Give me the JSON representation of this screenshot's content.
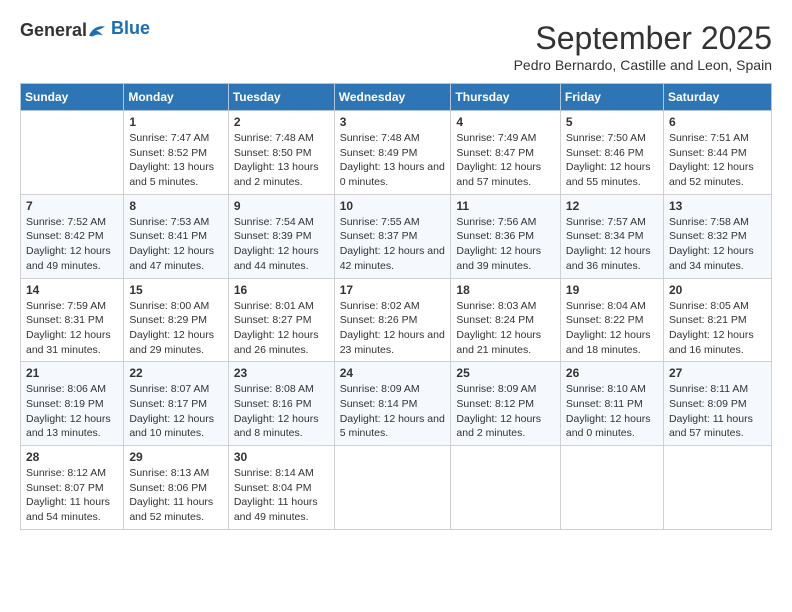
{
  "logo": {
    "general": "General",
    "blue": "Blue"
  },
  "title": "September 2025",
  "subtitle": "Pedro Bernardo, Castille and Leon, Spain",
  "weekdays": [
    "Sunday",
    "Monday",
    "Tuesday",
    "Wednesday",
    "Thursday",
    "Friday",
    "Saturday"
  ],
  "weeks": [
    [
      {
        "num": "",
        "sunrise": "",
        "sunset": "",
        "daylight": ""
      },
      {
        "num": "1",
        "sunrise": "Sunrise: 7:47 AM",
        "sunset": "Sunset: 8:52 PM",
        "daylight": "Daylight: 13 hours and 5 minutes."
      },
      {
        "num": "2",
        "sunrise": "Sunrise: 7:48 AM",
        "sunset": "Sunset: 8:50 PM",
        "daylight": "Daylight: 13 hours and 2 minutes."
      },
      {
        "num": "3",
        "sunrise": "Sunrise: 7:48 AM",
        "sunset": "Sunset: 8:49 PM",
        "daylight": "Daylight: 13 hours and 0 minutes."
      },
      {
        "num": "4",
        "sunrise": "Sunrise: 7:49 AM",
        "sunset": "Sunset: 8:47 PM",
        "daylight": "Daylight: 12 hours and 57 minutes."
      },
      {
        "num": "5",
        "sunrise": "Sunrise: 7:50 AM",
        "sunset": "Sunset: 8:46 PM",
        "daylight": "Daylight: 12 hours and 55 minutes."
      },
      {
        "num": "6",
        "sunrise": "Sunrise: 7:51 AM",
        "sunset": "Sunset: 8:44 PM",
        "daylight": "Daylight: 12 hours and 52 minutes."
      }
    ],
    [
      {
        "num": "7",
        "sunrise": "Sunrise: 7:52 AM",
        "sunset": "Sunset: 8:42 PM",
        "daylight": "Daylight: 12 hours and 49 minutes."
      },
      {
        "num": "8",
        "sunrise": "Sunrise: 7:53 AM",
        "sunset": "Sunset: 8:41 PM",
        "daylight": "Daylight: 12 hours and 47 minutes."
      },
      {
        "num": "9",
        "sunrise": "Sunrise: 7:54 AM",
        "sunset": "Sunset: 8:39 PM",
        "daylight": "Daylight: 12 hours and 44 minutes."
      },
      {
        "num": "10",
        "sunrise": "Sunrise: 7:55 AM",
        "sunset": "Sunset: 8:37 PM",
        "daylight": "Daylight: 12 hours and 42 minutes."
      },
      {
        "num": "11",
        "sunrise": "Sunrise: 7:56 AM",
        "sunset": "Sunset: 8:36 PM",
        "daylight": "Daylight: 12 hours and 39 minutes."
      },
      {
        "num": "12",
        "sunrise": "Sunrise: 7:57 AM",
        "sunset": "Sunset: 8:34 PM",
        "daylight": "Daylight: 12 hours and 36 minutes."
      },
      {
        "num": "13",
        "sunrise": "Sunrise: 7:58 AM",
        "sunset": "Sunset: 8:32 PM",
        "daylight": "Daylight: 12 hours and 34 minutes."
      }
    ],
    [
      {
        "num": "14",
        "sunrise": "Sunrise: 7:59 AM",
        "sunset": "Sunset: 8:31 PM",
        "daylight": "Daylight: 12 hours and 31 minutes."
      },
      {
        "num": "15",
        "sunrise": "Sunrise: 8:00 AM",
        "sunset": "Sunset: 8:29 PM",
        "daylight": "Daylight: 12 hours and 29 minutes."
      },
      {
        "num": "16",
        "sunrise": "Sunrise: 8:01 AM",
        "sunset": "Sunset: 8:27 PM",
        "daylight": "Daylight: 12 hours and 26 minutes."
      },
      {
        "num": "17",
        "sunrise": "Sunrise: 8:02 AM",
        "sunset": "Sunset: 8:26 PM",
        "daylight": "Daylight: 12 hours and 23 minutes."
      },
      {
        "num": "18",
        "sunrise": "Sunrise: 8:03 AM",
        "sunset": "Sunset: 8:24 PM",
        "daylight": "Daylight: 12 hours and 21 minutes."
      },
      {
        "num": "19",
        "sunrise": "Sunrise: 8:04 AM",
        "sunset": "Sunset: 8:22 PM",
        "daylight": "Daylight: 12 hours and 18 minutes."
      },
      {
        "num": "20",
        "sunrise": "Sunrise: 8:05 AM",
        "sunset": "Sunset: 8:21 PM",
        "daylight": "Daylight: 12 hours and 16 minutes."
      }
    ],
    [
      {
        "num": "21",
        "sunrise": "Sunrise: 8:06 AM",
        "sunset": "Sunset: 8:19 PM",
        "daylight": "Daylight: 12 hours and 13 minutes."
      },
      {
        "num": "22",
        "sunrise": "Sunrise: 8:07 AM",
        "sunset": "Sunset: 8:17 PM",
        "daylight": "Daylight: 12 hours and 10 minutes."
      },
      {
        "num": "23",
        "sunrise": "Sunrise: 8:08 AM",
        "sunset": "Sunset: 8:16 PM",
        "daylight": "Daylight: 12 hours and 8 minutes."
      },
      {
        "num": "24",
        "sunrise": "Sunrise: 8:09 AM",
        "sunset": "Sunset: 8:14 PM",
        "daylight": "Daylight: 12 hours and 5 minutes."
      },
      {
        "num": "25",
        "sunrise": "Sunrise: 8:09 AM",
        "sunset": "Sunset: 8:12 PM",
        "daylight": "Daylight: 12 hours and 2 minutes."
      },
      {
        "num": "26",
        "sunrise": "Sunrise: 8:10 AM",
        "sunset": "Sunset: 8:11 PM",
        "daylight": "Daylight: 12 hours and 0 minutes."
      },
      {
        "num": "27",
        "sunrise": "Sunrise: 8:11 AM",
        "sunset": "Sunset: 8:09 PM",
        "daylight": "Daylight: 11 hours and 57 minutes."
      }
    ],
    [
      {
        "num": "28",
        "sunrise": "Sunrise: 8:12 AM",
        "sunset": "Sunset: 8:07 PM",
        "daylight": "Daylight: 11 hours and 54 minutes."
      },
      {
        "num": "29",
        "sunrise": "Sunrise: 8:13 AM",
        "sunset": "Sunset: 8:06 PM",
        "daylight": "Daylight: 11 hours and 52 minutes."
      },
      {
        "num": "30",
        "sunrise": "Sunrise: 8:14 AM",
        "sunset": "Sunset: 8:04 PM",
        "daylight": "Daylight: 11 hours and 49 minutes."
      },
      {
        "num": "",
        "sunrise": "",
        "sunset": "",
        "daylight": ""
      },
      {
        "num": "",
        "sunrise": "",
        "sunset": "",
        "daylight": ""
      },
      {
        "num": "",
        "sunrise": "",
        "sunset": "",
        "daylight": ""
      },
      {
        "num": "",
        "sunrise": "",
        "sunset": "",
        "daylight": ""
      }
    ]
  ]
}
